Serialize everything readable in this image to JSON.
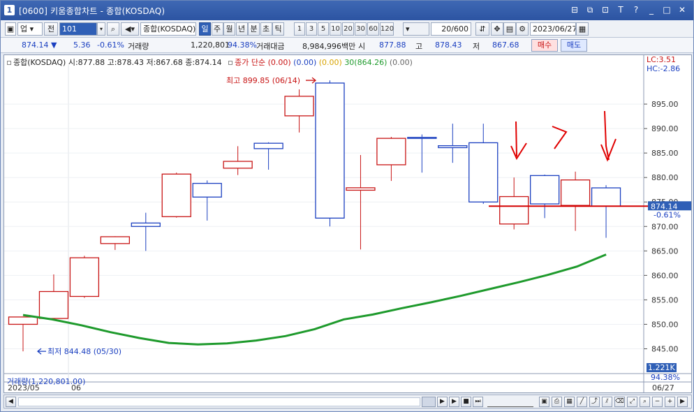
{
  "window": {
    "number": "1",
    "title": "[0600] 키움종합차트 - 종합(KOSDAQ)",
    "title_icons": [
      "layout-icon",
      "copy-icon",
      "link-icon",
      "font-icon",
      "help-icon",
      "minimize-icon",
      "maximize-icon",
      "close-icon"
    ],
    "title_glyphs": [
      "⊟",
      "⧉",
      "⊡",
      "T",
      "?",
      "_",
      "□",
      "✕"
    ]
  },
  "toolbar": {
    "market_select": "업",
    "all_button": "전",
    "code_input": "101",
    "search_glyph": "🔍",
    "sound_glyph": "◀",
    "name_field": "종합(KOSDAQ)",
    "period_buttons": [
      "일",
      "주",
      "월",
      "년",
      "분",
      "초",
      "틱"
    ],
    "active_period": "일",
    "interval_buttons": [
      "1",
      "3",
      "5",
      "10",
      "20",
      "30",
      "60",
      "120"
    ],
    "count_field": "20",
    "count_total": "/600",
    "date_field": "2023/06/27"
  },
  "quote": {
    "price": "874.14",
    "change_arrow": "▼",
    "change": "5.36",
    "change_pct": "-0.61%",
    "volume_label": "거래량",
    "volume": "1,220,801",
    "volume_ratio": "94.38%",
    "amount_label": "거래대금",
    "amount": "8,984,996백만",
    "open_label": "시",
    "open": "877.88",
    "high_label": "고",
    "high": "878.43",
    "low_label": "저",
    "low": "867.68",
    "buy_button": "매수",
    "sell_button": "매도"
  },
  "legend": {
    "main": "종합(KOSDAQ) 시:877.88 고:878.43 저:867.68 종:874.14",
    "ma_label": "종가 단순",
    "ma_values": [
      "(0.00)",
      "(0.00)",
      "(0.00)"
    ],
    "ma30_label": "30(864.26)",
    "ma_last": "(0.00)"
  },
  "right_axis": {
    "lc": "LC:3.51",
    "hc": "HC:-2.86",
    "ticks": [
      "895.00",
      "890.00",
      "885.00",
      "880.00",
      "875.00",
      "870.00",
      "865.00",
      "860.00",
      "855.00",
      "850.00",
      "845.00"
    ],
    "current_price": "874.14",
    "current_pct": "-0.61%",
    "volume_badge": "1.221K",
    "volume_pct": "94.38%"
  },
  "annotations": {
    "high_text": "최고 899.85 (06/14)",
    "low_text": "최저 844.48 (05/30)",
    "volume_footer": "거래량(1,220,801.00)"
  },
  "x_axis": {
    "left_label": "2023/05",
    "mid_label": "06",
    "right_label": "06/27"
  },
  "colors": {
    "up": "#c81414",
    "down": "#1a3fc0",
    "ma": "#1e9a2c",
    "accent": "#2f5fb6"
  },
  "chart_data": {
    "type": "candlestick",
    "ylim": [
      842.5,
      903
    ],
    "candles": [
      {
        "open": 850.0,
        "high": 851.5,
        "low": 844.48,
        "close": 851.5
      },
      {
        "open": 851.2,
        "high": 860.2,
        "low": 850.8,
        "close": 856.7
      },
      {
        "open": 855.7,
        "high": 864.0,
        "low": 855.4,
        "close": 863.6
      },
      {
        "open": 866.5,
        "high": 868.0,
        "low": 865.2,
        "close": 867.9
      },
      {
        "open": 870.7,
        "high": 872.8,
        "low": 865.0,
        "close": 870.0
      },
      {
        "open": 872.0,
        "high": 881.0,
        "low": 871.8,
        "close": 880.7
      },
      {
        "open": 878.8,
        "high": 879.4,
        "low": 871.2,
        "close": 876.0
      },
      {
        "open": 881.9,
        "high": 886.4,
        "low": 880.5,
        "close": 883.3
      },
      {
        "open": 887.0,
        "high": 887.2,
        "low": 881.6,
        "close": 885.9
      },
      {
        "open": 892.6,
        "high": 898.0,
        "low": 889.2,
        "close": 896.6
      },
      {
        "open": 899.3,
        "high": 899.85,
        "low": 870.0,
        "close": 871.7
      },
      {
        "open": 877.4,
        "high": 884.6,
        "low": 865.3,
        "close": 877.9
      },
      {
        "open": 882.6,
        "high": 888.3,
        "low": 879.3,
        "close": 888.0
      },
      {
        "open": 888.2,
        "high": 888.8,
        "low": 881.0,
        "close": 888.1
      },
      {
        "open": 886.5,
        "high": 891.0,
        "low": 883.0,
        "close": 886.1
      },
      {
        "open": 887.1,
        "high": 891.0,
        "low": 874.6,
        "close": 875.0
      },
      {
        "open": 870.5,
        "high": 880.0,
        "low": 869.4,
        "close": 876.1
      },
      {
        "open": 880.4,
        "high": 880.6,
        "low": 871.7,
        "close": 874.6
      },
      {
        "open": 874.3,
        "high": 881.2,
        "low": 869.1,
        "close": 879.5
      },
      {
        "open": 877.88,
        "high": 878.43,
        "low": 867.68,
        "close": 874.14
      }
    ],
    "ma30": [
      851.9,
      851.0,
      849.8,
      848.4,
      847.2,
      846.2,
      845.9,
      846.1,
      846.7,
      847.6,
      849.0,
      851.0,
      852.0,
      853.3,
      854.5,
      855.8,
      857.2,
      858.6,
      860.1,
      861.8,
      864.26
    ],
    "high_marker": 899.85,
    "low_marker": 844.48
  }
}
